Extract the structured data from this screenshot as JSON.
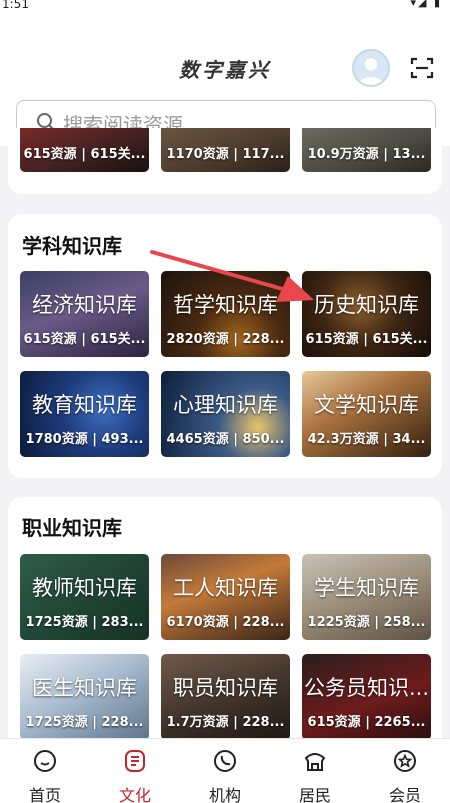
{
  "status_bar": {
    "time": "1:51",
    "icons": "▾◢ ▮"
  },
  "header": {
    "title": "数字嘉兴",
    "search_placeholder": "搜索阅读资源"
  },
  "top_partial_row": [
    {
      "stats": "615资源 | 615关..."
    },
    {
      "stats": "1170资源 | 117..."
    },
    {
      "stats": "10.9万资源 | 13..."
    }
  ],
  "subject_section": {
    "title": "学科知识库",
    "tiles": [
      {
        "name": "经济知识库",
        "stats": "615资源 | 615关..."
      },
      {
        "name": "哲学知识库",
        "stats": "2820资源 | 228..."
      },
      {
        "name": "历史知识库",
        "stats": "615资源 | 615关..."
      },
      {
        "name": "教育知识库",
        "stats": "1780资源 | 493..."
      },
      {
        "name": "心理知识库",
        "stats": "4465资源 | 850..."
      },
      {
        "name": "文学知识库",
        "stats": "42.3万资源 | 34..."
      }
    ]
  },
  "career_section": {
    "title": "职业知识库",
    "tiles": [
      {
        "name": "教师知识库",
        "stats": "1725资源 | 283..."
      },
      {
        "name": "工人知识库",
        "stats": "6170资源 | 228..."
      },
      {
        "name": "学生知识库",
        "stats": "1225资源 | 258..."
      },
      {
        "name": "医生知识库",
        "stats": "1725资源 | 228..."
      },
      {
        "name": "职员知识库",
        "stats": "1.7万资源 | 228..."
      },
      {
        "name": "公务员知识...",
        "stats": "615资源 | 2265..."
      }
    ]
  },
  "tabbar": {
    "active_color": "#c0272d",
    "items": [
      {
        "label": "首页",
        "icon": "home-icon"
      },
      {
        "label": "文化",
        "icon": "culture-icon"
      },
      {
        "label": "机构",
        "icon": "institution-icon"
      },
      {
        "label": "居民",
        "icon": "resident-icon"
      },
      {
        "label": "会员",
        "icon": "member-icon"
      }
    ]
  }
}
